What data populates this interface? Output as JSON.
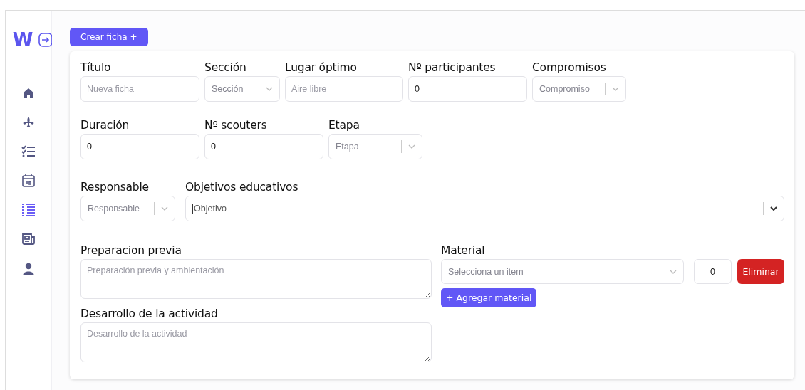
{
  "sidebar": {
    "logo": "W",
    "items": [
      {
        "kind": "home",
        "selected": false
      },
      {
        "kind": "fleur",
        "selected": false
      },
      {
        "kind": "checklist",
        "selected": false
      },
      {
        "kind": "calendar",
        "selected": false
      },
      {
        "kind": "list",
        "selected": true
      },
      {
        "kind": "news",
        "selected": false
      },
      {
        "kind": "user",
        "selected": false
      }
    ]
  },
  "create_button": "Crear ficha +",
  "form": {
    "rows": [
      {
        "fields": [
          {
            "kind": "input",
            "label": "Título",
            "placeholder": "Nueva ficha"
          },
          {
            "kind": "select",
            "label": "Sección",
            "placeholder": "Sección"
          },
          {
            "kind": "input",
            "label": "Lugar óptimo",
            "placeholder": "Aire libre"
          },
          {
            "kind": "input",
            "label": "Nº participantes",
            "value": "0"
          },
          {
            "kind": "select",
            "label": "Compromisos",
            "placeholder": "Compromiso"
          }
        ]
      },
      {
        "fields": [
          {
            "kind": "input",
            "label": "Duración",
            "value": "0"
          },
          {
            "kind": "input",
            "label": "Nº scouters",
            "value": "0"
          },
          {
            "kind": "select",
            "label": "Etapa",
            "placeholder": "Etapa"
          }
        ]
      },
      {
        "fields": [
          {
            "kind": "select",
            "label": "Responsable",
            "placeholder": "Responsable"
          },
          {
            "kind": "multiselect",
            "label": "Objetivos educativos",
            "placeholder": "Objetivo"
          }
        ]
      }
    ],
    "text_areas": [
      {
        "label": "Preparacion previa",
        "placeholder": "Preparación previa y ambientación"
      },
      {
        "label": "Desarrollo de la actividad",
        "placeholder": "Desarrollo de la actividad"
      }
    ],
    "material": {
      "label": "Material",
      "items": [
        {
          "placeholder": "Selecciona un item",
          "quantity": "0",
          "remove_button": "Eliminar"
        }
      ],
      "add_button": "+ Agregar material"
    }
  }
}
